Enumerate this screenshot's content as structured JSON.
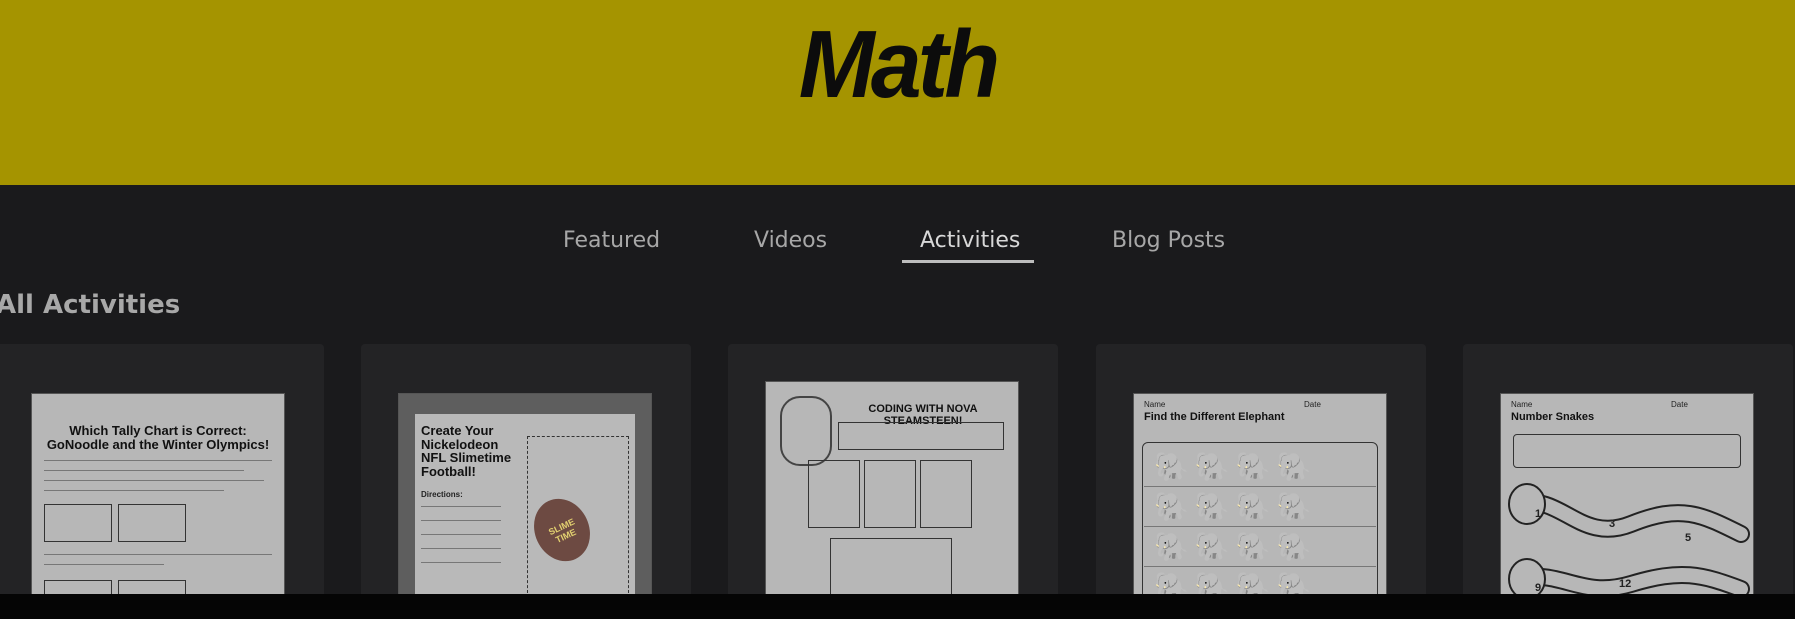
{
  "header": {
    "title": "Math",
    "background": "#a59400"
  },
  "tabs": [
    {
      "label": "Featured",
      "active": false
    },
    {
      "label": "Videos",
      "active": false
    },
    {
      "label": "Activities",
      "active": true
    },
    {
      "label": "Blog Posts",
      "active": false
    }
  ],
  "section": {
    "title": "All Activities"
  },
  "cards": [
    {
      "title": "Which Tally Chart is Correct: GoNoodle and the Winter Olympics!"
    },
    {
      "title": "Create Your Nickelodeon NFL Slimetime Football!",
      "directions": "Directions:",
      "badge": "SLIME TIME"
    },
    {
      "title": "CODING WITH NOVA STEAMSTEEN!"
    },
    {
      "title": "Find the Different Elephant",
      "name_label": "Name",
      "date_label": "Date"
    },
    {
      "title": "Number Snakes",
      "name_label": "Name",
      "date_label": "Date",
      "numbers": [
        "1",
        "3",
        "5",
        "9",
        "12"
      ]
    }
  ]
}
